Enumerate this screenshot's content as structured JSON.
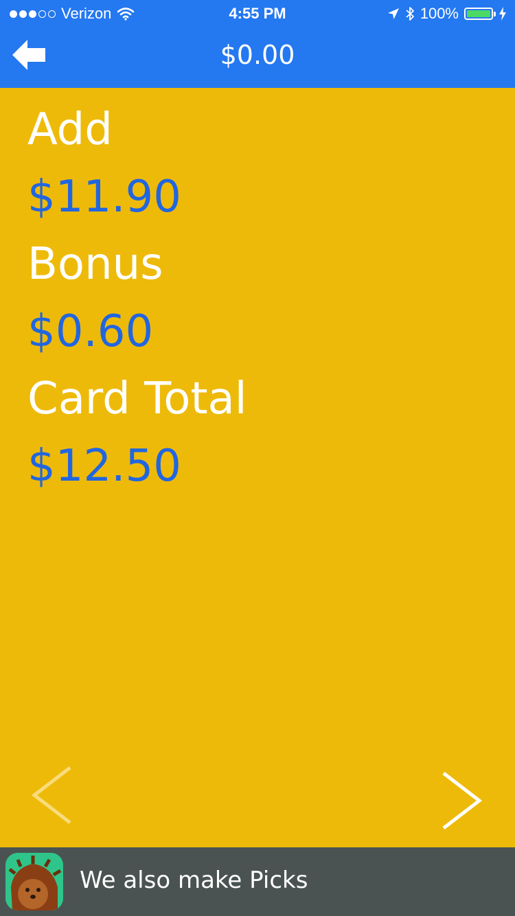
{
  "status_bar": {
    "carrier": "Verizon",
    "time": "4:55 PM",
    "battery": "100%",
    "signal_bars_filled": 3,
    "signal_bars_total": 5,
    "icons": [
      "wifi-icon",
      "location-arrow-icon",
      "bluetooth-icon",
      "battery-icon",
      "charging-bolt-icon"
    ]
  },
  "nav": {
    "title": "$0.00",
    "back_icon": "back-arrow-icon"
  },
  "summary": {
    "add_label": "Add",
    "add_value": "$11.90",
    "bonus_label": "Bonus",
    "bonus_value": "$0.60",
    "total_label": "Card Total",
    "total_value": "$12.50"
  },
  "pager": {
    "prev_icon": "chevron-left-icon",
    "next_icon": "chevron-right-icon"
  },
  "banner": {
    "text": "We also make Picks",
    "icon": "picks-app-icon"
  },
  "colors": {
    "nav_blue": "#2478F0",
    "background_yellow": "#EEBA0A",
    "value_blue": "#2166E0",
    "banner_gray": "#4A5351"
  }
}
